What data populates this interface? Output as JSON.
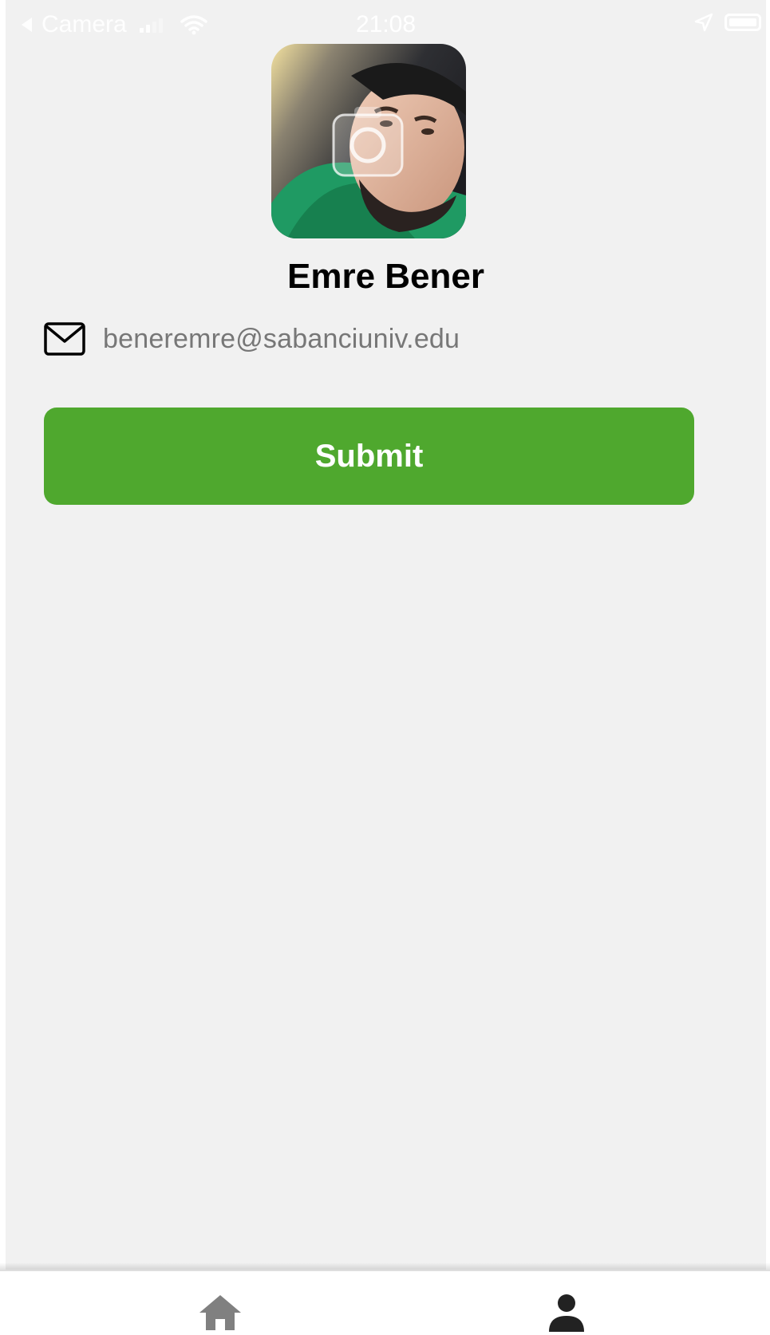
{
  "status_bar": {
    "back_app": "Camera",
    "time": "21:08"
  },
  "profile": {
    "name": "Emre Bener",
    "email": "beneremre@sabanciuniv.edu",
    "avatar_icon": "camera-icon"
  },
  "actions": {
    "submit_label": "Submit"
  },
  "tab_bar": {
    "items": [
      {
        "icon": "home-icon",
        "active": false
      },
      {
        "icon": "person-icon",
        "active": true
      }
    ]
  },
  "colors": {
    "background": "#f1f1f1",
    "accent": "#4fa82e",
    "text_primary": "#000000",
    "text_secondary": "#777777",
    "tab_icon": "#808080",
    "tab_icon_active": "#222222"
  }
}
